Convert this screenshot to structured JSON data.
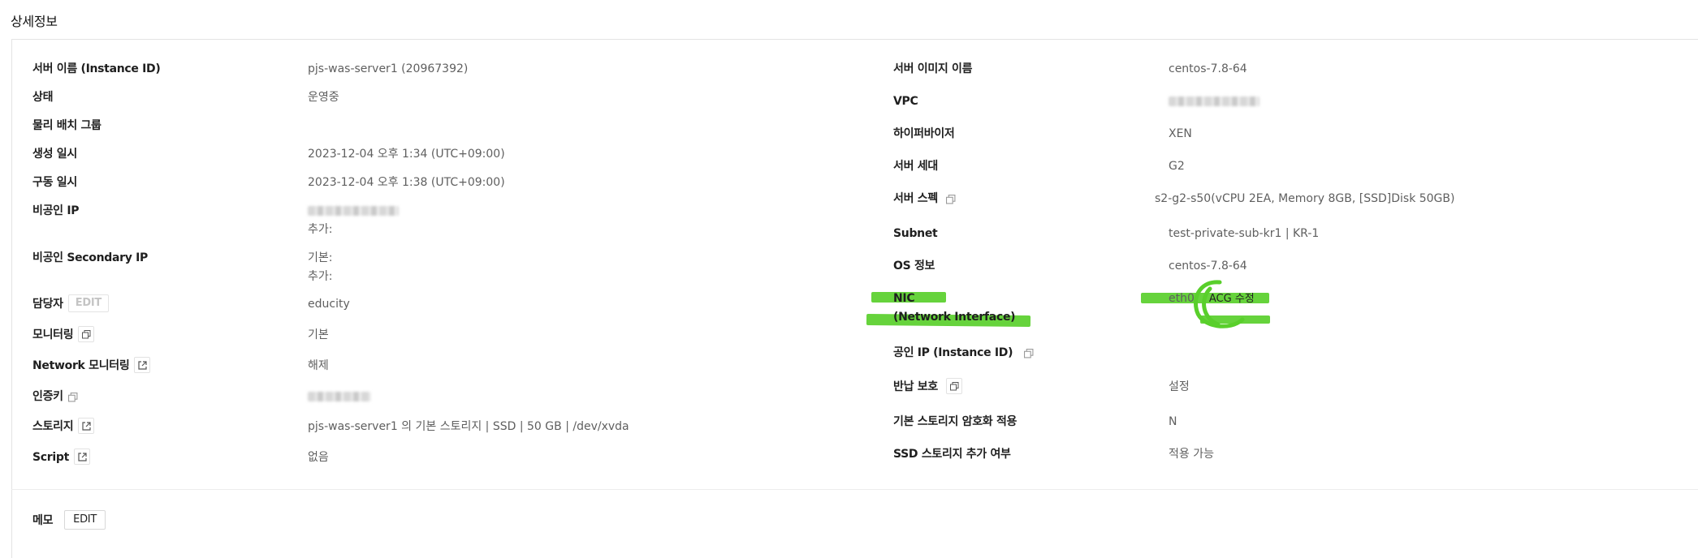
{
  "title": "상세정보",
  "left": [
    {
      "label": "서버 이름 (Instance ID)",
      "value": "pjs-was-server1 (20967392)"
    },
    {
      "label": "상태",
      "value": "운영중"
    },
    {
      "label": "물리 배치 그룹",
      "value": ""
    },
    {
      "label": "생성 일시",
      "value": "2023-12-04 오후 1:34 (UTC+09:00)"
    },
    {
      "label": "구동 일시",
      "value": "2023-12-04 오후 1:38 (UTC+09:00)"
    },
    {
      "label": "비공인 IP",
      "value_line2": "추가:"
    },
    {
      "label": "비공인 Secondary IP",
      "value": "기본:",
      "value_line2": "추가:"
    },
    {
      "label": "담당자",
      "edit": "EDIT",
      "value": "educity"
    },
    {
      "label": "모니터링",
      "value": "기본"
    },
    {
      "label": "Network 모니터링",
      "value": "해제"
    },
    {
      "label": "인증키",
      "value": ""
    },
    {
      "label": "스토리지",
      "value": "pjs-was-server1 의 기본 스토리지 | SSD | 50 GB | /dev/xvda"
    },
    {
      "label": "Script",
      "value": "없음"
    }
  ],
  "right": [
    {
      "label": "서버 이미지 이름",
      "value": "centos-7.8-64"
    },
    {
      "label": "VPC",
      "value": ""
    },
    {
      "label": "하이퍼바이저",
      "value": "XEN"
    },
    {
      "label": "서버 세대",
      "value": "G2"
    },
    {
      "label": "서버 스펙",
      "value": "s2-g2-s50(vCPU 2EA, Memory 8GB, [SSD]Disk 50GB)"
    },
    {
      "label": "Subnet",
      "value": "test-private-sub-kr1 | KR-1"
    },
    {
      "label": "OS 정보",
      "value": "centos-7.8-64"
    },
    {
      "label": "NIC",
      "label_line2": "(Network Interface)",
      "value": "eth0",
      "button": "ACG 수정"
    },
    {
      "label": "공인 IP (Instance ID)",
      "value": ""
    },
    {
      "label": "반납 보호",
      "value": "설정"
    },
    {
      "label": "기본 스토리지 암호화 적용",
      "value": "N"
    },
    {
      "label": "SSD 스토리지 추가 여부",
      "value": "적용 가능"
    }
  ],
  "memo": {
    "label": "메모",
    "edit": "EDIT"
  },
  "colors": {
    "highlight": "#59cf2b",
    "label": "#1f1f1f",
    "value": "#5f5f5f",
    "border": "#e3e3e3"
  },
  "icons": {
    "copy": "copy-icon",
    "external": "external-link-icon"
  }
}
